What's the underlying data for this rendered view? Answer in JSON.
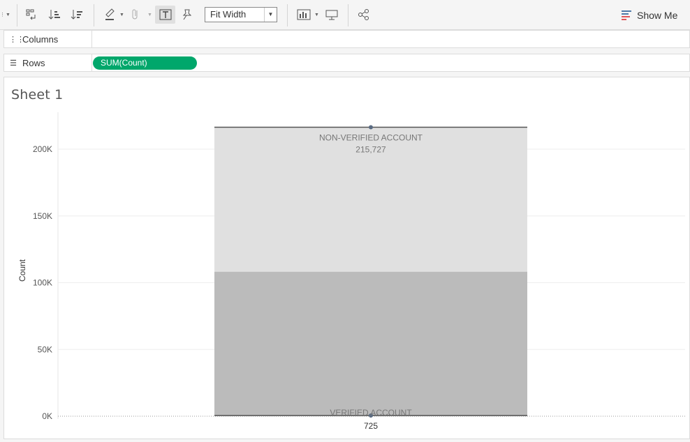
{
  "toolbar": {
    "fit_width": "Fit Width",
    "show_me": "Show Me",
    "icons": [
      "caret-icon",
      "swap-icon",
      "sort-ascending-icon",
      "sort-descending-icon",
      "highlight-icon",
      "paperclip-icon",
      "label-icon",
      "pin-icon",
      "bar-chart-icon",
      "presentation-icon",
      "share-icon",
      "show-me-icon"
    ]
  },
  "shelves": {
    "columns_label": "Columns",
    "rows_label": "Rows",
    "rows_pill": "SUM(Count)"
  },
  "sheet": {
    "title": "Sheet 1"
  },
  "colors": {
    "pill": "#00a76b",
    "bar_top": "#e0e0e0",
    "bar_bottom": "#bbbbbb"
  },
  "chart_data": {
    "type": "bar",
    "stacked": true,
    "ylabel": "Count",
    "ylim": [
      0,
      225000
    ],
    "yticks": [
      0,
      50000,
      100000,
      150000,
      200000
    ],
    "ytick_labels": [
      "0K",
      "50K",
      "100K",
      "150K",
      "200K"
    ],
    "grid": true,
    "series": [
      {
        "name": "VERIFIED ACCOUNT",
        "value": 725,
        "label": "725",
        "color": "#bbbbbb"
      },
      {
        "name": "NON-VERIFIED ACCOUNT",
        "value": 215727,
        "label": "215,727",
        "color": "#e0e0e0"
      }
    ]
  }
}
